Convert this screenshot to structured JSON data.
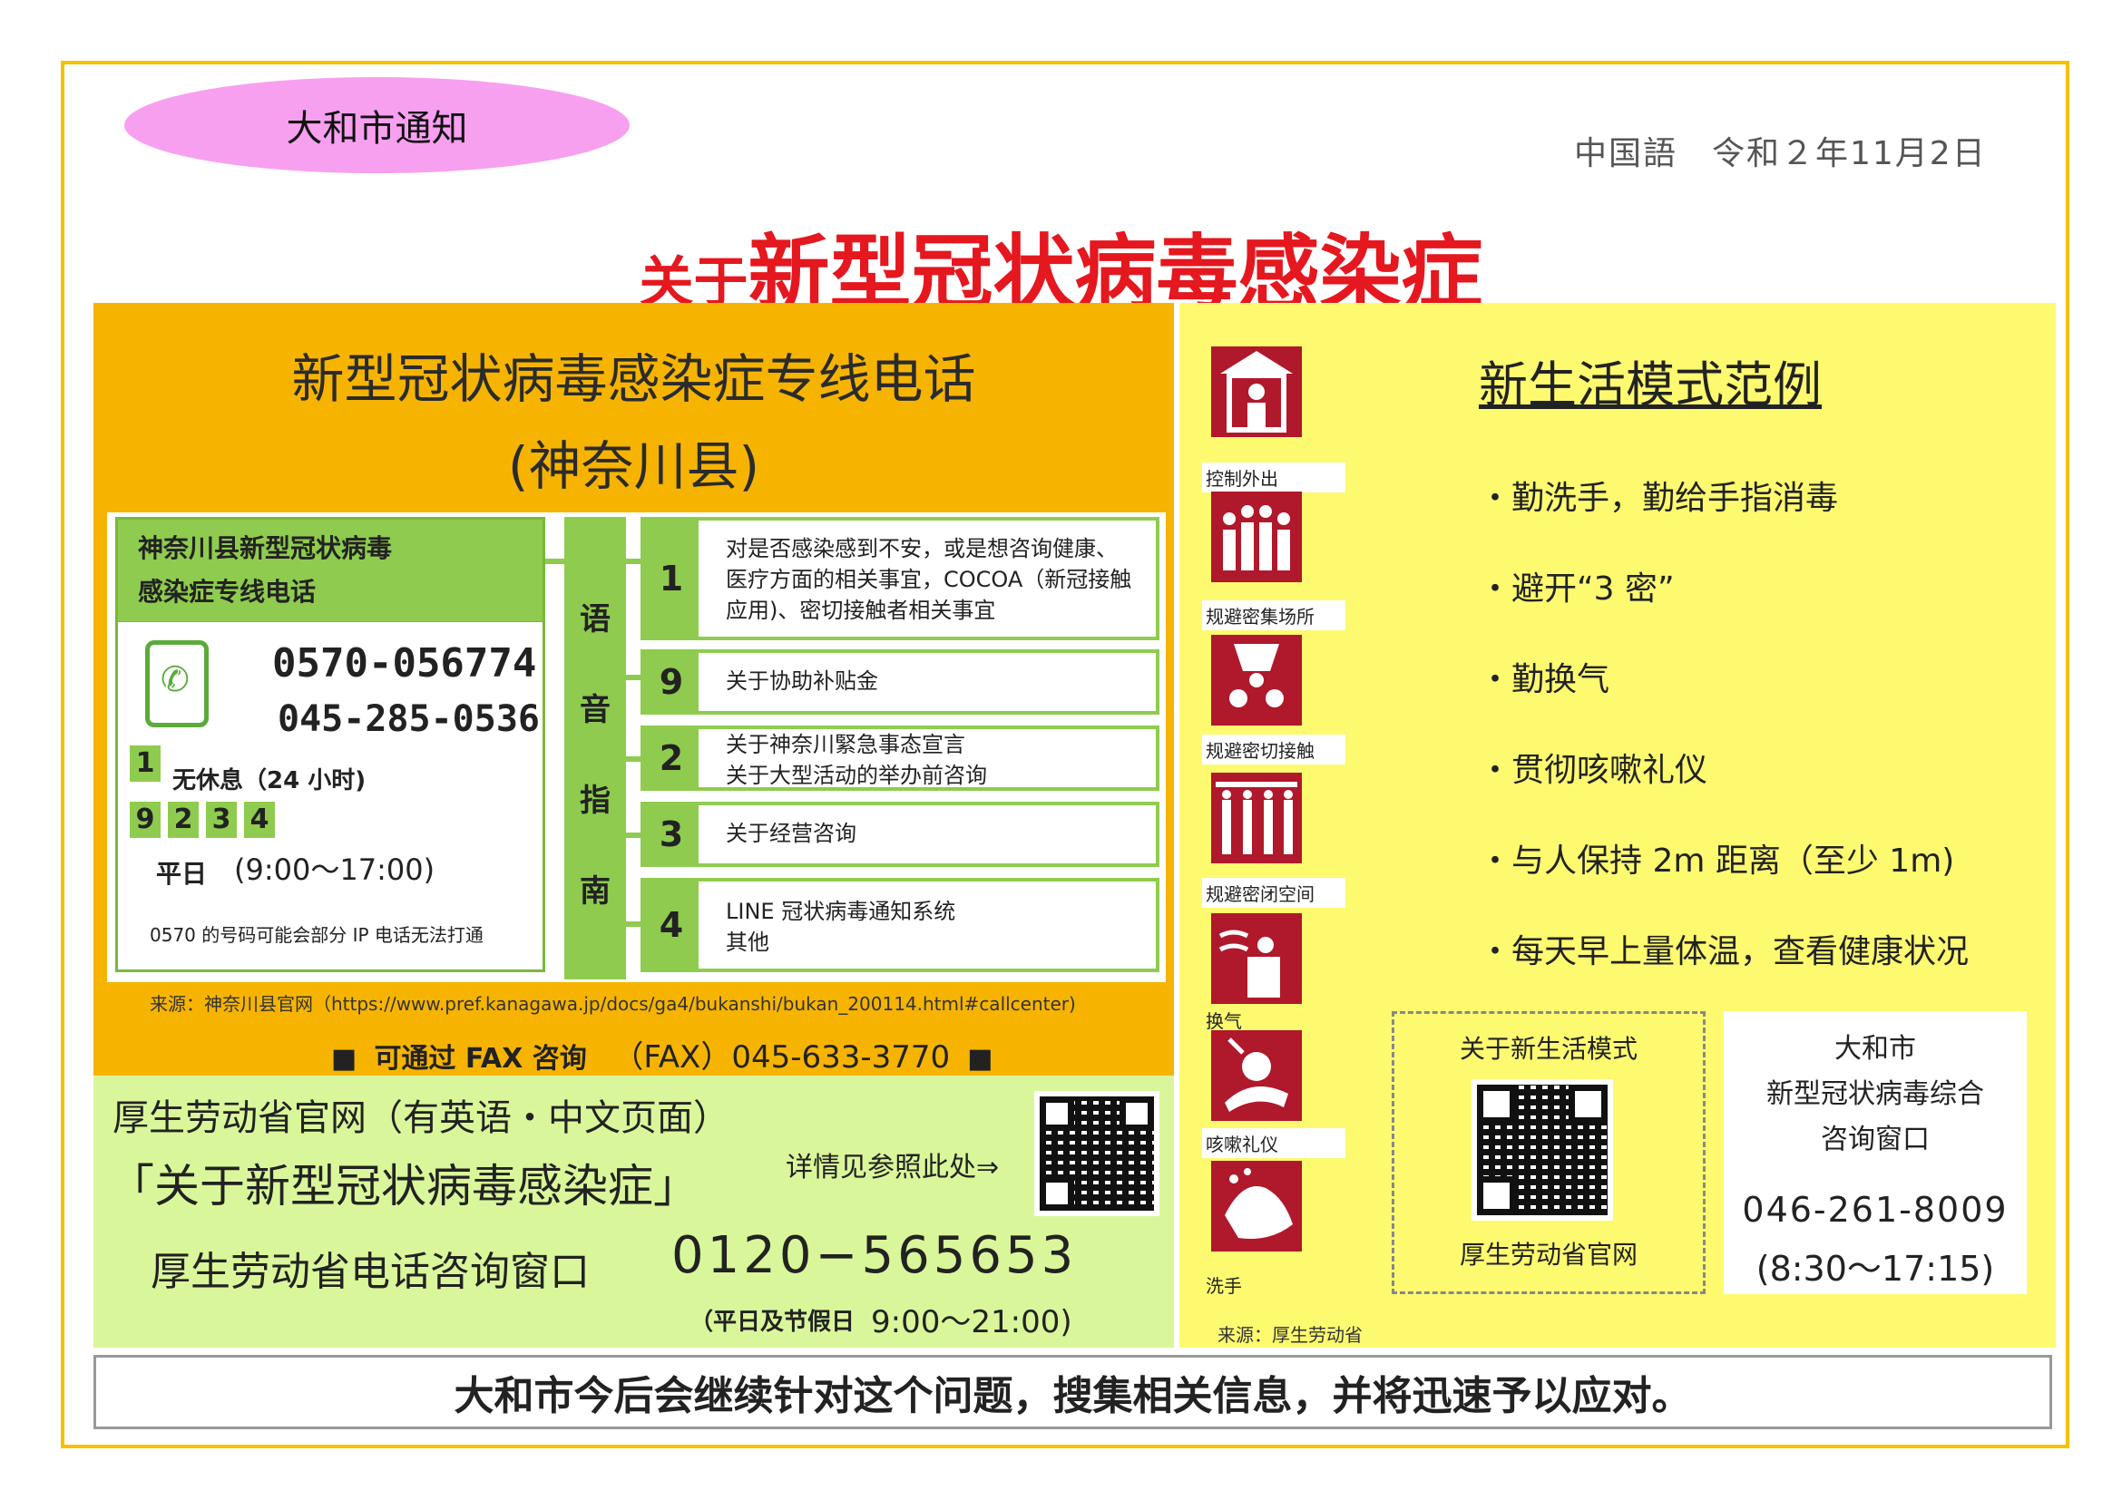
{
  "badge": "大和市通知",
  "date": "中国語　令和２年11月2日",
  "headline": {
    "prefix": "关于",
    "main": "新型冠状病毒感染症"
  },
  "hotline": {
    "title_line1": "新型冠状病毒感染症专线电话",
    "title_line2": "(神奈川县)",
    "box_title_line1": "神奈川县新型冠状病毒",
    "box_title_line2": "感染症专线电话",
    "phone1": "0570-056774",
    "phone2": "045-285-0536",
    "key_24h": "1",
    "label_24h": "无休息（24 小时)",
    "keys_weekday": [
      "9",
      "2",
      "3",
      "4"
    ],
    "label_weekday": "平日",
    "hours_weekday": "(9:00〜17:00)",
    "note": "0570 的号码可能会部分 IP 电话无法打通",
    "voice_guide": [
      "语",
      "音",
      "指",
      "南"
    ],
    "options": [
      {
        "num": "1",
        "lines": [
          "对是否感染感到不安，或是想咨询健康、",
          "医疗方面的相关事宜，COCOA（新冠接触",
          "应用)、密切接触者相关事宜"
        ]
      },
      {
        "num": "9",
        "lines": [
          "关于协助补贴金"
        ]
      },
      {
        "num": "2",
        "lines": [
          "关于神奈川緊急事态宣言",
          "关于大型活动的举办前咨询"
        ]
      },
      {
        "num": "3",
        "lines": [
          "关于经营咨询"
        ]
      },
      {
        "num": "4",
        "lines": [
          "LINE 冠状病毒通知系统",
          "其他"
        ]
      }
    ],
    "source": "来源：神奈川县官网（https://www.pref.kanagawa.jp/docs/ga4/bukanshi/bukan_200114.html#callcenter)",
    "fax_label": "可通过 FAX 咨询",
    "fax_number": "（FAX）045-633-3770"
  },
  "mhlw": {
    "site_line": "厚生劳动省官网（有英语・中文页面）",
    "title": "「关于新型冠状病毒感染症」",
    "see_here": "详情见参照此处⇒",
    "tel_label": "厚生劳动省电话咨询窗口",
    "tel_number": "0120−565653",
    "hours_label": "（平日及节假日",
    "hours_time": "9:00〜21:00)"
  },
  "newlife": {
    "title": "新生活模式范例",
    "icons": [
      {
        "label": "控制外出",
        "icon": "house-person-icon"
      },
      {
        "label": "规避密集场所",
        "icon": "crowd-icon"
      },
      {
        "label": "规避密切接触",
        "icon": "close-contact-icon"
      },
      {
        "label": "规避密闭空间",
        "icon": "closed-space-icon"
      },
      {
        "label": "换气",
        "icon": "ventilation-icon"
      },
      {
        "label": "咳嗽礼仪",
        "icon": "cough-etiquette-icon"
      },
      {
        "label": "洗手",
        "icon": "handwash-icon"
      }
    ],
    "bullets": [
      "・勤洗手，勤给手指消毒",
      "・避开“3 密”",
      "・勤换气",
      "・贯彻咳嗽礼仪",
      "・与人保持 2m 距离（至少 1m)",
      "・每天早上量体温，查看健康状况"
    ],
    "qr_caption_top": "关于新生活模式",
    "qr_caption_bottom": "厚生劳动省官网",
    "city_line1": "大和市",
    "city_line2": "新型冠状病毒综合",
    "city_line3": "咨询窗口",
    "city_phone": "046-261-8009",
    "city_hours": "(8:30〜17:15)",
    "source": "来源：厚生劳动省"
  },
  "footer": "大和市今后会继续针对这个问题，搜集相关信息，并将迅速予以应对。",
  "colors": {
    "orange": "#f6b400",
    "green": "#8fcb4e",
    "lightgreen": "#d9f79a",
    "yellow": "#fdfa70",
    "red": "#e5171f",
    "iconred": "#b0182b",
    "pink": "#f8a0f0",
    "frame": "#f2c200"
  }
}
